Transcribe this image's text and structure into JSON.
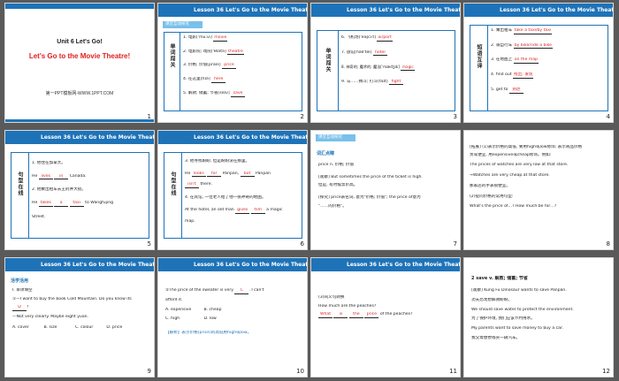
{
  "header_title": "Lesson 36 Let's Go to the Movie Theatre!",
  "slides": [
    {
      "num": "1",
      "unit": "Unit 6 Let's Go!",
      "title": "Let's Go to the Movie Theatre!",
      "footer": "第一PPT模板网-WWW.1PPT.COM"
    },
    {
      "num": "2",
      "tag": "课堂互动探究",
      "section": "单词闯关",
      "items": [
        {
          "label": "1. 电影[ˈmuːvi]",
          "answer": "movie"
        },
        {
          "label": "2. 电影院; 戏院[ˈθɪətə]",
          "answer": "theatre"
        },
        {
          "label": "3. 价格; 价值[praɪs]",
          "answer": "price"
        },
        {
          "label": "4. 在这里[hɪə]",
          "answer": "here"
        },
        {
          "label": "5. 解救; 储蓄; 节省[seɪv]",
          "answer": "save"
        }
      ]
    },
    {
      "num": "3",
      "section": "单词闯关",
      "items": [
        {
          "label": "6. 飞机场[ˈeəpɔːt]",
          "answer": "airport"
        },
        {
          "label": "7. 旅馆[həʊˈtel]",
          "answer": "hotel"
        },
        {
          "label": "8. 神奇的; 魔术的; 魔法[ˈmædʒɪk]",
          "answer": "magic"
        },
        {
          "label": "9. 与……搏斗; 打斗[faɪt]",
          "answer": "fight"
        }
      ]
    },
    {
      "num": "4",
      "section": "短语互译",
      "items": [
        {
          "label": "1. 乘出租车",
          "answer": "take a taxi/by taxi"
        },
        {
          "label": "2. 骑自行车",
          "answer": "by bike/ride a bike"
        },
        {
          "label": "3. 在地图上",
          "answer": "on the map"
        },
        {
          "label": "4. find out",
          "answer": "找出; 发现"
        },
        {
          "label": "5. get to",
          "answer": "到达"
        }
      ]
    },
    {
      "num": "5",
      "section": "句型在线",
      "lines": [
        "1. 他住在加拿大。",
        "He",
        "lives",
        "in",
        "Canada.",
        "2. 他乘出租车去王府井大街。",
        "He",
        "takes",
        "a",
        "taxi",
        "to Wangfujing",
        "Street."
      ]
    },
    {
      "num": "6",
      "section": "句型在线",
      "lines": [
        "3. 他寻找盼盼, 但是盼盼没在那里。",
        "He",
        "looks",
        "for",
        "Panpan,",
        "but",
        "Panpan",
        "isn't",
        "there.",
        "4. 在宾馆, 一位老人给了他一张神奇的地图。",
        "At the hotel, an old man",
        "gives",
        "him",
        "a magic",
        "map."
      ]
    },
    {
      "num": "7",
      "tag": "课堂互动探究",
      "subtitle": "词汇点睛",
      "lines": [
        "price n. 价格; 价值",
        "[观察] But sometimes the price of the ticket is high.",
        "但是, 有时候票价高。",
        "[探究] price表名词, 意为\"价格; 价值\"; the price of意为",
        "\"……的价格\"。"
      ]
    },
    {
      "num": "8",
      "lines": [
        "[拓展] (1)表示价格的高低, 要用high或low修饰; 表示商品价格",
        "贵或便宜, 用expensive或cheap修饰。例如:",
        "The prices of watches are very low at that store.",
        "→Watches are very cheap at that store.",
        "那家店的手表很便宜。",
        "(2)提问价格的常用句型:",
        "What's the price of…? How much be for…?"
      ]
    },
    {
      "num": "9",
      "subtitle": "活学活用",
      "lines": [
        "Ⅰ. 单项填空",
        "①—I want to buy the book Cold Mountain. Do you know its",
        "D",
        "?",
        "—Not very clearly. Maybe eight yuan.",
        "A. cover",
        "B. size",
        "C. colour",
        "D. price"
      ]
    },
    {
      "num": "10",
      "lines": [
        "②The price of the sweater is very",
        "C",
        ". I can't",
        "afford it.",
        "A. expensive",
        "B. cheap",
        "C. high",
        "D. low",
        "【解析】表示价格(price)的高低用high或low。"
      ]
    },
    {
      "num": "11",
      "lines": [
        "(3)同义句转换",
        "How much are the peaches?",
        "What",
        "is",
        "the",
        "price",
        "of the peaches?"
      ]
    },
    {
      "num": "12",
      "lines": [
        "2 save v. 解救; 储蓄; 节省",
        "[观察] Kung Fu Dinosaur wants to save Panpan.",
        "功夫恐龙想解救盼盼。",
        "We should save water to protect the environment.",
        "为了保护环境, 我们应该节约用水。",
        "My parents want to save money to buy a car.",
        "我父母想攒钱买一辆汽车。"
      ]
    }
  ]
}
